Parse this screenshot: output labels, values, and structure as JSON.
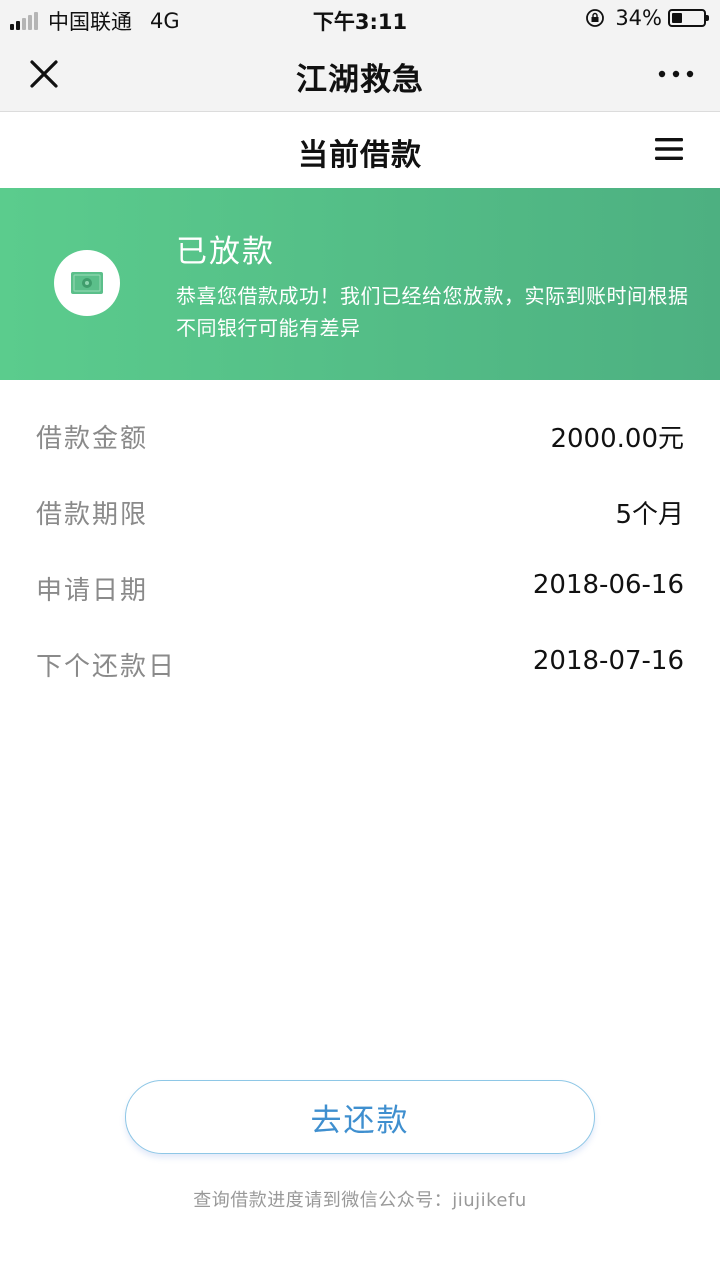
{
  "status_bar": {
    "carrier": "中国联通",
    "network": "4G",
    "time": "下午3:11",
    "battery_percent": "34%",
    "battery_level": 0.34
  },
  "nav": {
    "title": "江湖救急"
  },
  "page": {
    "title": "当前借款"
  },
  "banner": {
    "title": "已放款",
    "text": "恭喜您借款成功！我们已经给您放款，实际到账时间根据不同银行可能有差异",
    "color_start": "#5bcc8d",
    "color_end": "#4db081"
  },
  "details": [
    {
      "label": "借款金额",
      "value": "2000.00元"
    },
    {
      "label": "借款期限",
      "value": "5个月"
    },
    {
      "label": "申请日期",
      "value": "2018-06-16"
    },
    {
      "label": "下个还款日",
      "value": "2018-07-16"
    }
  ],
  "repay_button": {
    "label": "去还款"
  },
  "footer": {
    "note": "查询借款进度请到微信公众号：jiujikefu"
  }
}
